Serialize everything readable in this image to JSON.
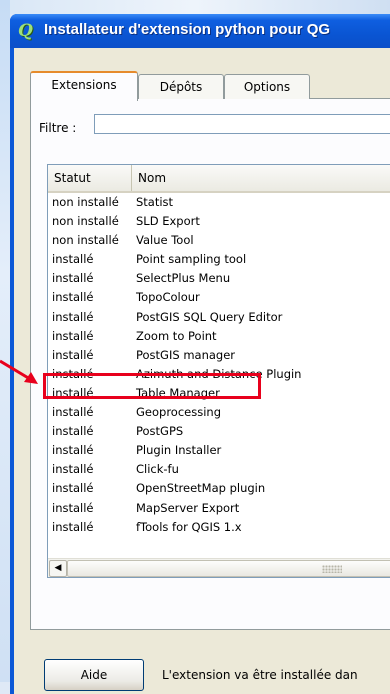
{
  "window": {
    "title": "Installateur d'extension python pour QG"
  },
  "tabs": [
    {
      "label": "Extensions"
    },
    {
      "label": "Dépôts"
    },
    {
      "label": "Options"
    }
  ],
  "filter": {
    "label": "Filtre :",
    "value": ""
  },
  "table": {
    "columns": [
      "Statut",
      "Nom"
    ],
    "rows": [
      {
        "statut": "non installé",
        "nom": "Statist"
      },
      {
        "statut": "non installé",
        "nom": "SLD Export"
      },
      {
        "statut": "non installé",
        "nom": "Value Tool"
      },
      {
        "statut": "installé",
        "nom": "Point sampling tool"
      },
      {
        "statut": "installé",
        "nom": "SelectPlus Menu"
      },
      {
        "statut": "installé",
        "nom": "TopoColour"
      },
      {
        "statut": "installé",
        "nom": "PostGIS SQL Query Editor"
      },
      {
        "statut": "installé",
        "nom": "Zoom to Point"
      },
      {
        "statut": "installé",
        "nom": "PostGIS manager"
      },
      {
        "statut": "installé",
        "nom": "Azimuth and Distance Plugin"
      },
      {
        "statut": "installé",
        "nom": "Table Manager"
      },
      {
        "statut": "installé",
        "nom": "Geoprocessing"
      },
      {
        "statut": "installé",
        "nom": "PostGPS"
      },
      {
        "statut": "installé",
        "nom": "Plugin Installer"
      },
      {
        "statut": "installé",
        "nom": "Click-fu"
      },
      {
        "statut": "installé",
        "nom": "OpenStreetMap plugin"
      },
      {
        "statut": "installé",
        "nom": "MapServer Export"
      },
      {
        "statut": "installé",
        "nom": "fTools for QGIS 1.x"
      }
    ],
    "highlighted_row": "Table Manager"
  },
  "scrollbar": {
    "left_arrow": "◀"
  },
  "footer": {
    "help_button": "Aide",
    "status": "L'extension va être installée dan"
  },
  "colors": {
    "titlebar": "#0b55d3",
    "highlight": "#e8001c",
    "dialog": "#ece9d8"
  }
}
